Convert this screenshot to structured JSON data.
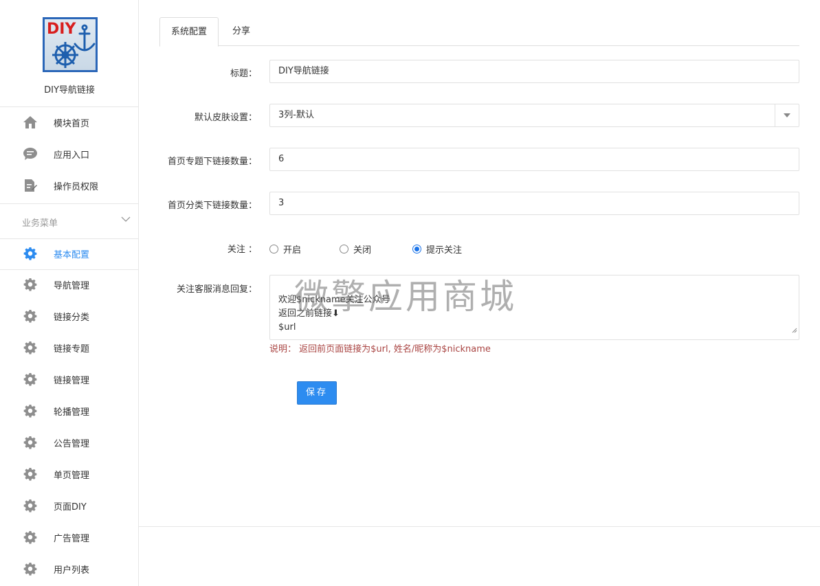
{
  "sidebar": {
    "logo_text": "DIY",
    "app_name": "DIY导航链接",
    "top_items": [
      {
        "label": "模块首页",
        "icon": "home-icon"
      },
      {
        "label": "应用入口",
        "icon": "chat-bubble-icon"
      },
      {
        "label": "操作员权限",
        "icon": "edit-document-icon"
      }
    ],
    "section_title": "业务菜单",
    "menu_items": [
      {
        "label": "基本配置",
        "icon": "gear-icon",
        "active": true
      },
      {
        "label": "导航管理",
        "icon": "gear-icon"
      },
      {
        "label": "链接分类",
        "icon": "gear-icon"
      },
      {
        "label": "链接专题",
        "icon": "gear-icon"
      },
      {
        "label": "链接管理",
        "icon": "gear-icon"
      },
      {
        "label": "轮播管理",
        "icon": "gear-icon"
      },
      {
        "label": "公告管理",
        "icon": "gear-icon"
      },
      {
        "label": "单页管理",
        "icon": "gear-icon"
      },
      {
        "label": "页面DIY",
        "icon": "gear-icon"
      },
      {
        "label": "广告管理",
        "icon": "gear-icon"
      },
      {
        "label": "用户列表",
        "icon": "gear-icon"
      }
    ],
    "active_color": "#2d8cf0"
  },
  "tabs": [
    {
      "label": "系统配置",
      "active": true
    },
    {
      "label": "分享",
      "active": false
    }
  ],
  "form": {
    "title_label": "标题：",
    "title_value": "DIY导航链接",
    "skin_label": "默认皮肤设置：",
    "skin_value": "3列-默认",
    "topic_links_label": "首页专题下链接数量：",
    "topic_links_value": "6",
    "category_links_label": "首页分类下链接数量：",
    "category_links_value": "3",
    "follow_label": "关注 ：",
    "follow_options": [
      "开启",
      "关闭",
      "提示关注"
    ],
    "follow_selected": "提示关注",
    "reply_label": "关注客服消息回复：",
    "reply_value": "欢迎$nickname关注公众号\n返回之前链接⬇\n$url",
    "hint": "说明： 返回前页面链接为$url, 姓名/昵称为$nickname",
    "save_label": "保存"
  },
  "watermark": "微擎应用商城",
  "colors": {
    "primary": "#2d8cf0",
    "hint": "#a94442"
  }
}
